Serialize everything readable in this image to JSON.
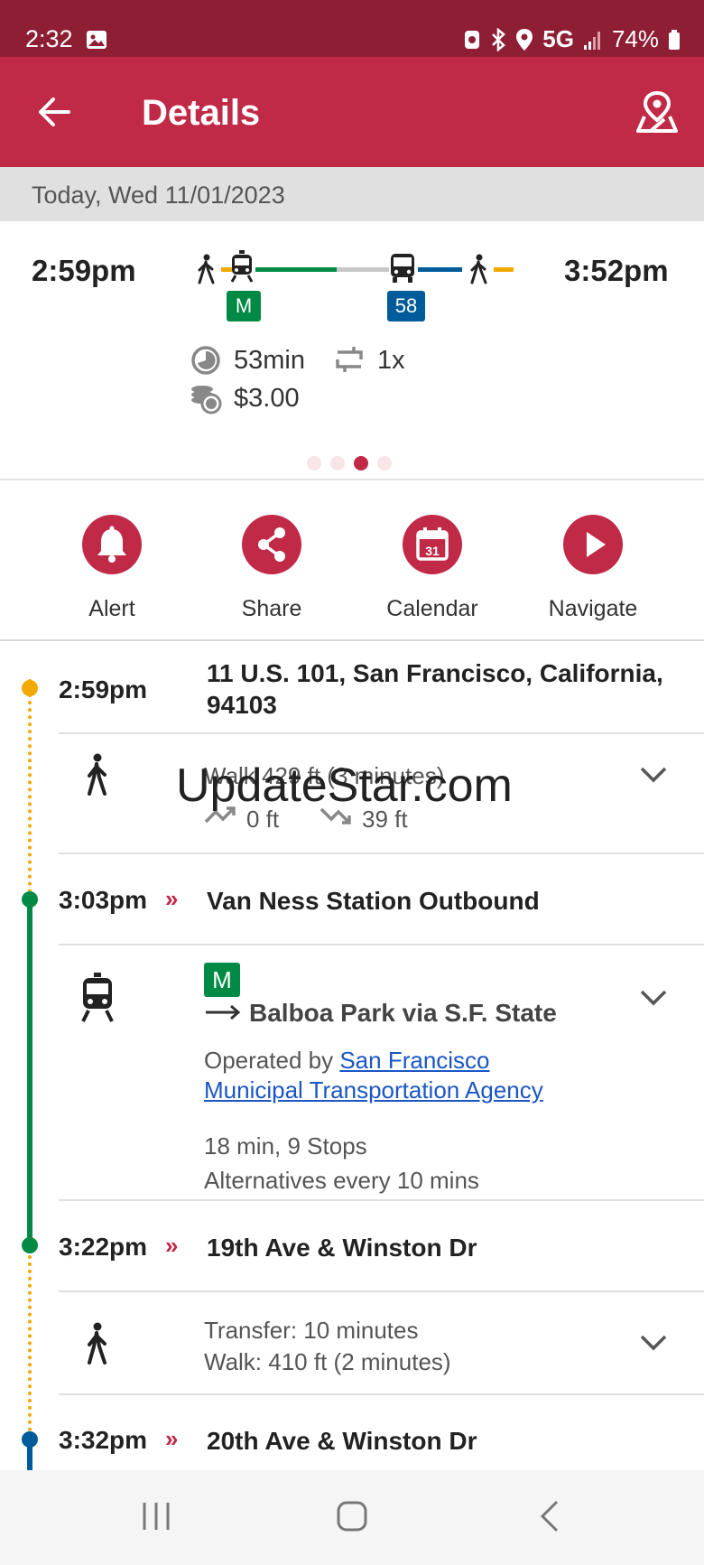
{
  "status_bar": {
    "time": "2:32",
    "network": "5G",
    "battery": "74%"
  },
  "app_bar": {
    "title": "Details"
  },
  "date": "Today, Wed 11/01/2023",
  "summary": {
    "departure": "2:59pm",
    "arrival": "3:52pm",
    "rail_badge": "M",
    "bus_badge": "58",
    "duration": "53min",
    "transfers": "1x",
    "fare": "$3.00",
    "page_count": 4,
    "active_page_index": 2
  },
  "colors": {
    "primary": "#c02a47",
    "status": "#8e1e34",
    "muni_green": "#008a45",
    "bus_blue": "#005b9a",
    "walk_orange": "#f2a900"
  },
  "actions": [
    {
      "label": "Alert",
      "icon": "bell-icon"
    },
    {
      "label": "Share",
      "icon": "share-icon"
    },
    {
      "label": "Calendar",
      "icon": "calendar-icon"
    },
    {
      "label": "Navigate",
      "icon": "play-icon"
    }
  ],
  "calendar_day": "31",
  "itinerary": {
    "origin": {
      "time": "2:59pm",
      "name_line1": "11 U.S. 101, San Francisco, California,",
      "name_line2": "94103"
    },
    "walk1": {
      "summary": "Walk 429 ft (3 minutes)",
      "up": "0 ft",
      "down": "39 ft"
    },
    "stop1": {
      "time": "3:03pm",
      "name": "Van Ness Station Outbound"
    },
    "ride": {
      "line": "M",
      "headsign": "Balboa Park via S.F. State",
      "operated_by": "Operated by",
      "agency_line1": "San Francisco",
      "agency_line2": "Municipal Transportation Agency",
      "stops": "18 min, 9 Stops",
      "frequency": "Alternatives every 10 mins"
    },
    "stop2": {
      "time": "3:22pm",
      "name": "19th Ave & Winston Dr"
    },
    "transfer": {
      "line1": "Transfer: 10 minutes",
      "line2": "Walk: 410 ft (2 minutes)"
    },
    "stop3": {
      "time": "3:32pm",
      "name": "20th Ave & Winston Dr"
    }
  },
  "watermark": "UpdateStar.com"
}
